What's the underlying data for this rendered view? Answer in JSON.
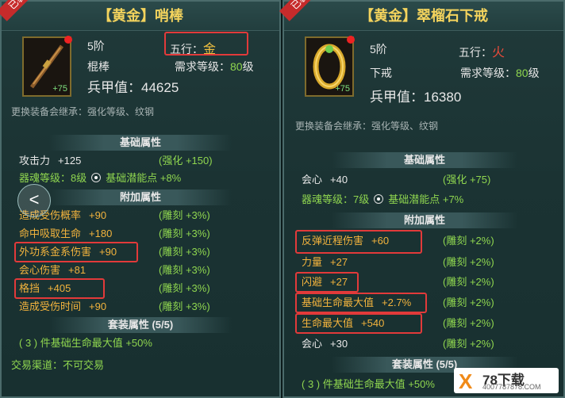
{
  "left": {
    "badge": "已装备",
    "title": "【黄金】哨棒",
    "tier": "5阶",
    "type": "棍棒",
    "plus": "+75",
    "element_label": "五行：",
    "element_value": "金",
    "req_label": "需求等级：",
    "req_value": "80",
    "req_unit": "级",
    "power_label": "兵甲值：",
    "power_value": "44625",
    "inherit_note": "更换装备会继承：强化等级、纹钢",
    "base_header": "基础属性",
    "base_attack_label": "攻击力",
    "base_attack_value": "+125",
    "base_attack_enh": "(强化 +150)",
    "soul_level": "器魂等级：8级",
    "potential": "基础潜能点 +8%",
    "extra_header": "附加属性",
    "extra": [
      {
        "name": "造成受伤概率",
        "value": "+90",
        "engrave": "(雕刻 +3%)"
      },
      {
        "name": "命中吸取生命",
        "value": "+180",
        "engrave": "(雕刻 +3%)"
      },
      {
        "name": "外功系金系伤害",
        "value": "+90",
        "engrave": "(雕刻 +3%)"
      },
      {
        "name": "会心伤害",
        "value": "+81",
        "engrave": "(雕刻 +3%)"
      },
      {
        "name": "格挡",
        "value": "+405",
        "engrave": "(雕刻 +3%)"
      },
      {
        "name": "造成受伤时间",
        "value": "+90",
        "engrave": "(雕刻 +3%)"
      }
    ],
    "set_header": "套装属性 (5/5)",
    "set_effect": "( 3 ) 件基础生命最大值  +50%",
    "trade": "交易渠道：不可交易"
  },
  "right": {
    "badge": "已装备",
    "title": "【黄金】翠榴石下戒",
    "tier": "5阶",
    "type": "下戒",
    "plus": "+75",
    "element_label": "五行：",
    "element_value": "火",
    "req_label": "需求等级：",
    "req_value": "80",
    "req_unit": "级",
    "power_label": "兵甲值：",
    "power_value": "16380",
    "inherit_note": "更换装备会继承：强化等级、纹钢",
    "base_header": "基础属性",
    "base_crit_label": "会心",
    "base_crit_value": "+40",
    "base_crit_enh": "(强化 +75)",
    "soul_level": "器魂等级：7级",
    "potential": "基础潜能点 +7%",
    "extra_header": "附加属性",
    "extra": [
      {
        "name": "反弹近程伤害",
        "value": "+60",
        "engrave": "(雕刻 +2%)"
      },
      {
        "name": "力量",
        "value": "+27",
        "engrave": "(雕刻 +2%)"
      },
      {
        "name": "闪避",
        "value": "+27",
        "engrave": "(雕刻 +2%)"
      },
      {
        "name": "基础生命最大值",
        "value": "+2.7%",
        "engrave": "(雕刻 +2%)"
      },
      {
        "name": "生命最大值",
        "value": "+540",
        "engrave": "(雕刻 +2%)"
      },
      {
        "name": "会心",
        "value": "+30",
        "engrave": "(雕刻 +2%)"
      }
    ],
    "set_header": "套装属性 (5/5)",
    "set_effect": "( 3 ) 件基础生命最大值  +50%"
  },
  "nav": {
    "back_glyph": "<"
  },
  "watermark": {
    "main": "78下载",
    "sub": "4007787878.COM"
  }
}
